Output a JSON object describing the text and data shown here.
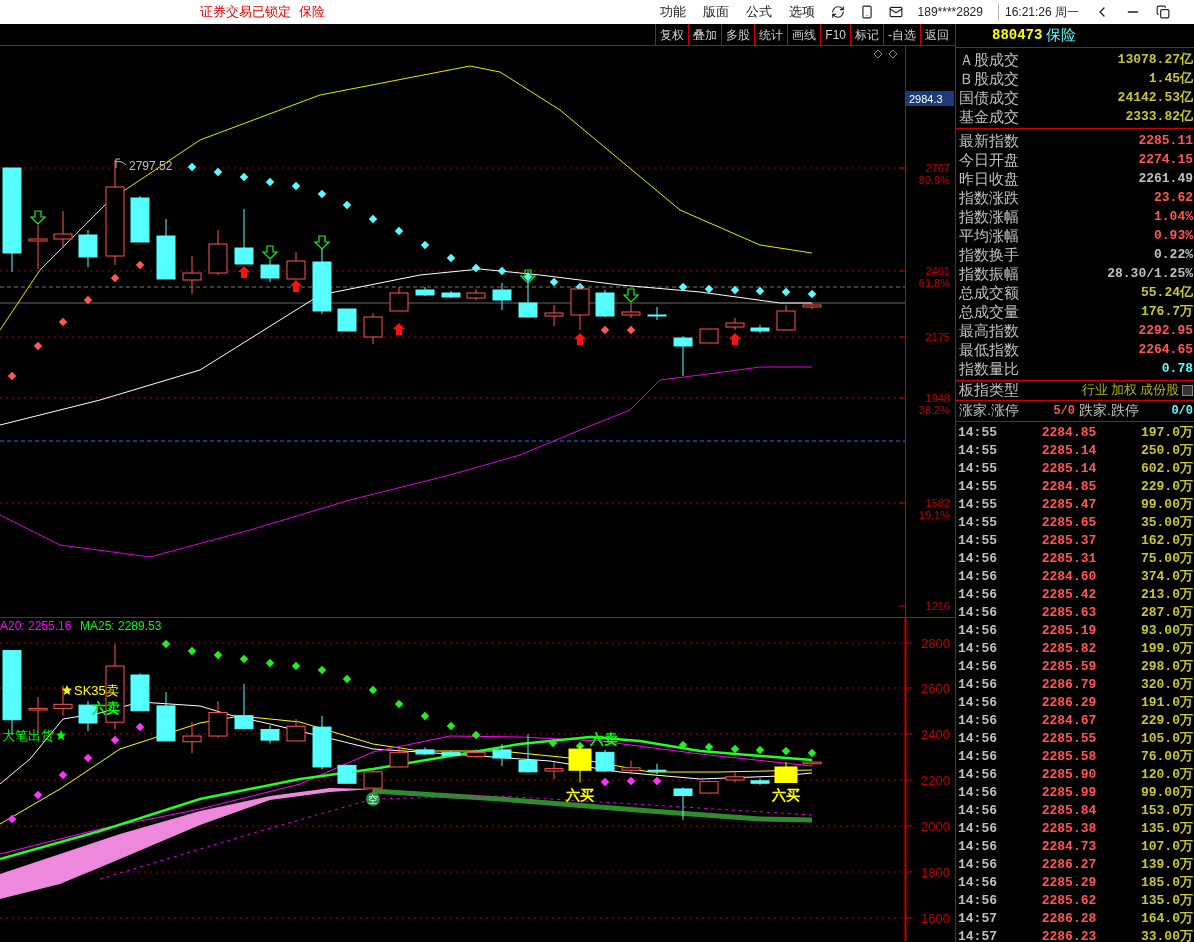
{
  "title_bar": {
    "lock_notice": "证券交易已锁定",
    "sector": "保险",
    "menu": [
      {
        "label": "功能"
      },
      {
        "label": "版面"
      },
      {
        "label": "公式"
      },
      {
        "label": "选项"
      }
    ],
    "account": "189****2829",
    "clock": "16:21:26 周一"
  },
  "toolbar": {
    "buttons": [
      "复权",
      "叠加",
      "多股",
      "统计",
      "画线",
      "F10",
      "标记",
      "-自选",
      "返回"
    ]
  },
  "main_chart": {
    "high_label": "2797.52",
    "price_tag": "2984.3",
    "axis": [
      {
        "value": "2767",
        "pct": "80.9%"
      },
      {
        "value": "2401",
        "pct": "61.8%"
      },
      {
        "value": "2175"
      },
      {
        "value": "1948",
        "pct": "38.2%"
      },
      {
        "value": "1582",
        "pct": "19.1%"
      },
      {
        "value": "1216"
      }
    ]
  },
  "indicator_chart": {
    "legend": [
      {
        "text": "A20: 2255.16",
        "color": "#ff00ff"
      },
      {
        "text": "MA25: 2289.53",
        "color": "#00ff00"
      }
    ],
    "signals": [
      {
        "kind": "star",
        "text": "SK35卖",
        "color": "#ffff00"
      },
      {
        "kind": "plain",
        "text": "六卖",
        "color": "#00ff00"
      },
      {
        "kind": "star_after",
        "text": "大笔出货",
        "color": "#00ff00"
      },
      {
        "kind": "circle",
        "text": "空",
        "color": "#1e9a4a"
      },
      {
        "kind": "plain",
        "text": "六卖",
        "color": "#00ff00"
      },
      {
        "kind": "plain",
        "text": "六买",
        "color": "#ffff00"
      },
      {
        "kind": "plain",
        "text": "六买",
        "color": "#ffff00"
      }
    ],
    "axis": [
      "2800",
      "2600",
      "2400",
      "2200",
      "2000",
      "1800",
      "1600"
    ]
  },
  "quote_header": {
    "code": "880473",
    "name": "保险"
  },
  "market_turnover": [
    {
      "label": "Ａ股成交",
      "value": "13078.27亿",
      "color": "#c8c832"
    },
    {
      "label": "Ｂ股成交",
      "value": "1.45亿",
      "color": "#c8c832"
    },
    {
      "label": "国债成交",
      "value": "24142.53亿",
      "color": "#c8c832"
    },
    {
      "label": "基金成交",
      "value": "2333.82亿",
      "color": "#c8c832"
    }
  ],
  "index_stats": [
    {
      "label": "最新指数",
      "value": "2285.11",
      "color": "#ff5555"
    },
    {
      "label": "今日开盘",
      "value": "2274.15",
      "color": "#ff5555"
    },
    {
      "label": "昨日收盘",
      "value": "2261.49",
      "color": "#c0c0c0"
    },
    {
      "label": "指数涨跌",
      "value": "23.62",
      "color": "#ff5555"
    },
    {
      "label": "指数涨幅",
      "value": "1.04%",
      "color": "#ff5555"
    },
    {
      "label": "平均涨幅",
      "value": "0.93%",
      "color": "#ff5555"
    },
    {
      "label": "指数换手",
      "value": "0.22%",
      "color": "#c0c0c0"
    },
    {
      "label": "指数振幅",
      "value": "28.30/1.25%",
      "color": "#c0c0c0"
    },
    {
      "label": "总成交额",
      "value": "55.24亿",
      "color": "#c8c832"
    },
    {
      "label": "总成交量",
      "value": "176.7万",
      "color": "#c8c832"
    },
    {
      "label": "最高指数",
      "value": "2292.95",
      "color": "#ff5555"
    },
    {
      "label": "最低指数",
      "value": "2264.65",
      "color": "#ff5555"
    },
    {
      "label": "指数量比",
      "value": "0.78",
      "color": "#55ffff"
    }
  ],
  "sector_type": {
    "label": "板指类型",
    "tags": [
      "行业",
      "加权",
      "成份股"
    ]
  },
  "breadth": [
    {
      "label": "涨家.涨停",
      "value": "5/0",
      "color": "#ff5555"
    },
    {
      "label": "跌家.跌停",
      "value": "0/0",
      "color": "#55ffff"
    }
  ],
  "ticks": [
    {
      "time": "14:55",
      "price": "2284.85",
      "volume": "197.0万"
    },
    {
      "time": "14:55",
      "price": "2285.14",
      "volume": "250.0万"
    },
    {
      "time": "14:55",
      "price": "2285.14",
      "volume": "602.0万"
    },
    {
      "time": "14:55",
      "price": "2284.85",
      "volume": "229.0万"
    },
    {
      "time": "14:55",
      "price": "2285.47",
      "volume": "99.00万"
    },
    {
      "time": "14:55",
      "price": "2285.65",
      "volume": "35.00万"
    },
    {
      "time": "14:55",
      "price": "2285.37",
      "volume": "162.0万"
    },
    {
      "time": "14:56",
      "price": "2285.31",
      "volume": "75.00万"
    },
    {
      "time": "14:56",
      "price": "2284.60",
      "volume": "374.0万"
    },
    {
      "time": "14:56",
      "price": "2285.42",
      "volume": "213.0万"
    },
    {
      "time": "14:56",
      "price": "2285.63",
      "volume": "287.0万"
    },
    {
      "time": "14:56",
      "price": "2285.19",
      "volume": "93.00万"
    },
    {
      "time": "14:56",
      "price": "2285.82",
      "volume": "199.0万"
    },
    {
      "time": "14:56",
      "price": "2285.59",
      "volume": "298.0万"
    },
    {
      "time": "14:56",
      "price": "2286.79",
      "volume": "320.0万"
    },
    {
      "time": "14:56",
      "price": "2286.29",
      "volume": "191.0万"
    },
    {
      "time": "14:56",
      "price": "2284.67",
      "volume": "229.0万"
    },
    {
      "time": "14:56",
      "price": "2285.55",
      "volume": "105.0万"
    },
    {
      "time": "14:56",
      "price": "2285.58",
      "volume": "76.00万"
    },
    {
      "time": "14:56",
      "price": "2285.90",
      "volume": "120.0万"
    },
    {
      "time": "14:56",
      "price": "2285.99",
      "volume": "99.00万"
    },
    {
      "time": "14:56",
      "price": "2285.84",
      "volume": "153.0万"
    },
    {
      "time": "14:56",
      "price": "2285.38",
      "volume": "135.0万"
    },
    {
      "time": "14:56",
      "price": "2284.73",
      "volume": "107.0万"
    },
    {
      "time": "14:56",
      "price": "2286.27",
      "volume": "139.0万"
    },
    {
      "time": "14:56",
      "price": "2285.29",
      "volume": "185.0万"
    },
    {
      "time": "14:56",
      "price": "2285.62",
      "volume": "135.0万"
    },
    {
      "time": "14:57",
      "price": "2286.28",
      "volume": "164.0万"
    },
    {
      "time": "14:57",
      "price": "2286.23",
      "volume": "33.00万"
    }
  ]
}
